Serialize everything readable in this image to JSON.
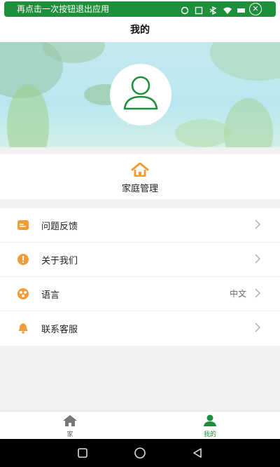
{
  "toast": {
    "message": "再点击一次按钮退出应用",
    "close_glyph": "✕"
  },
  "header": {
    "title": "我的"
  },
  "profile": {
    "nickname": "未设置"
  },
  "family": {
    "label": "家庭管理"
  },
  "menu": {
    "items": [
      {
        "label": "问题反馈",
        "icon": "feedback-icon",
        "value": ""
      },
      {
        "label": "关于我们",
        "icon": "info-icon",
        "value": ""
      },
      {
        "label": "语言",
        "icon": "language-icon",
        "value": "中文"
      },
      {
        "label": "联系客服",
        "icon": "bell-icon",
        "value": ""
      }
    ]
  },
  "bottom_nav": {
    "home_label": "家",
    "mine_label": "我的"
  },
  "colors": {
    "accent_green": "#1e8f3a",
    "icon_orange": "#f29b38"
  }
}
